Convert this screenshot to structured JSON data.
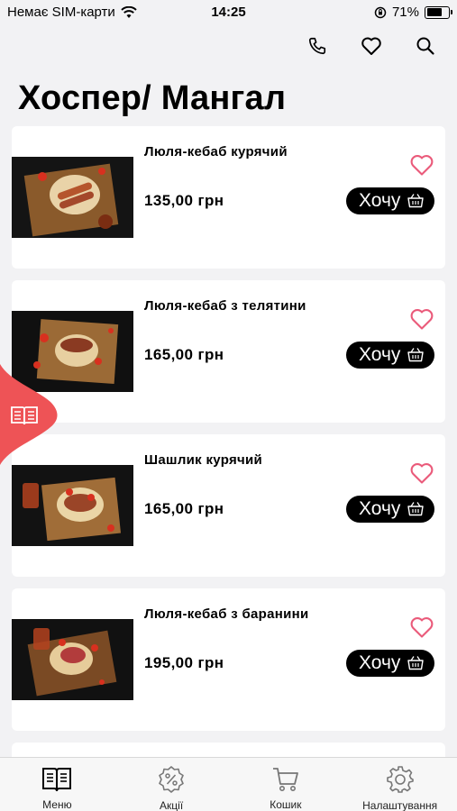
{
  "status_bar": {
    "carrier": "Немає SIM-карти",
    "time": "14:25",
    "battery_percent": "71%",
    "battery_level": 0.71
  },
  "page_title": "Хоспер/ Мангал",
  "header_icons": [
    "phone-icon",
    "heart-icon",
    "search-icon"
  ],
  "products": [
    {
      "name": "Люля-кебаб курячий",
      "price": "135,00 грн",
      "button": "Хочу"
    },
    {
      "name": "Люля-кебаб з телятини",
      "price": "165,00 грн",
      "button": "Хочу"
    },
    {
      "name": "Шашлик курячий",
      "price": "165,00 грн",
      "button": "Хочу"
    },
    {
      "name": "Люля-кебаб з баранини",
      "price": "195,00 грн",
      "button": "Хочу"
    }
  ],
  "tabs": [
    {
      "label": "Меню",
      "icon": "menu-book-icon"
    },
    {
      "label": "Акції",
      "icon": "discount-badge-icon"
    },
    {
      "label": "Кошик",
      "icon": "cart-icon"
    },
    {
      "label": "Налаштування",
      "icon": "settings-gear-icon"
    }
  ],
  "colors": {
    "accent": "#ee5356",
    "heart": "#ea5a7a",
    "background": "#f2f2f4",
    "button": "#000000"
  }
}
